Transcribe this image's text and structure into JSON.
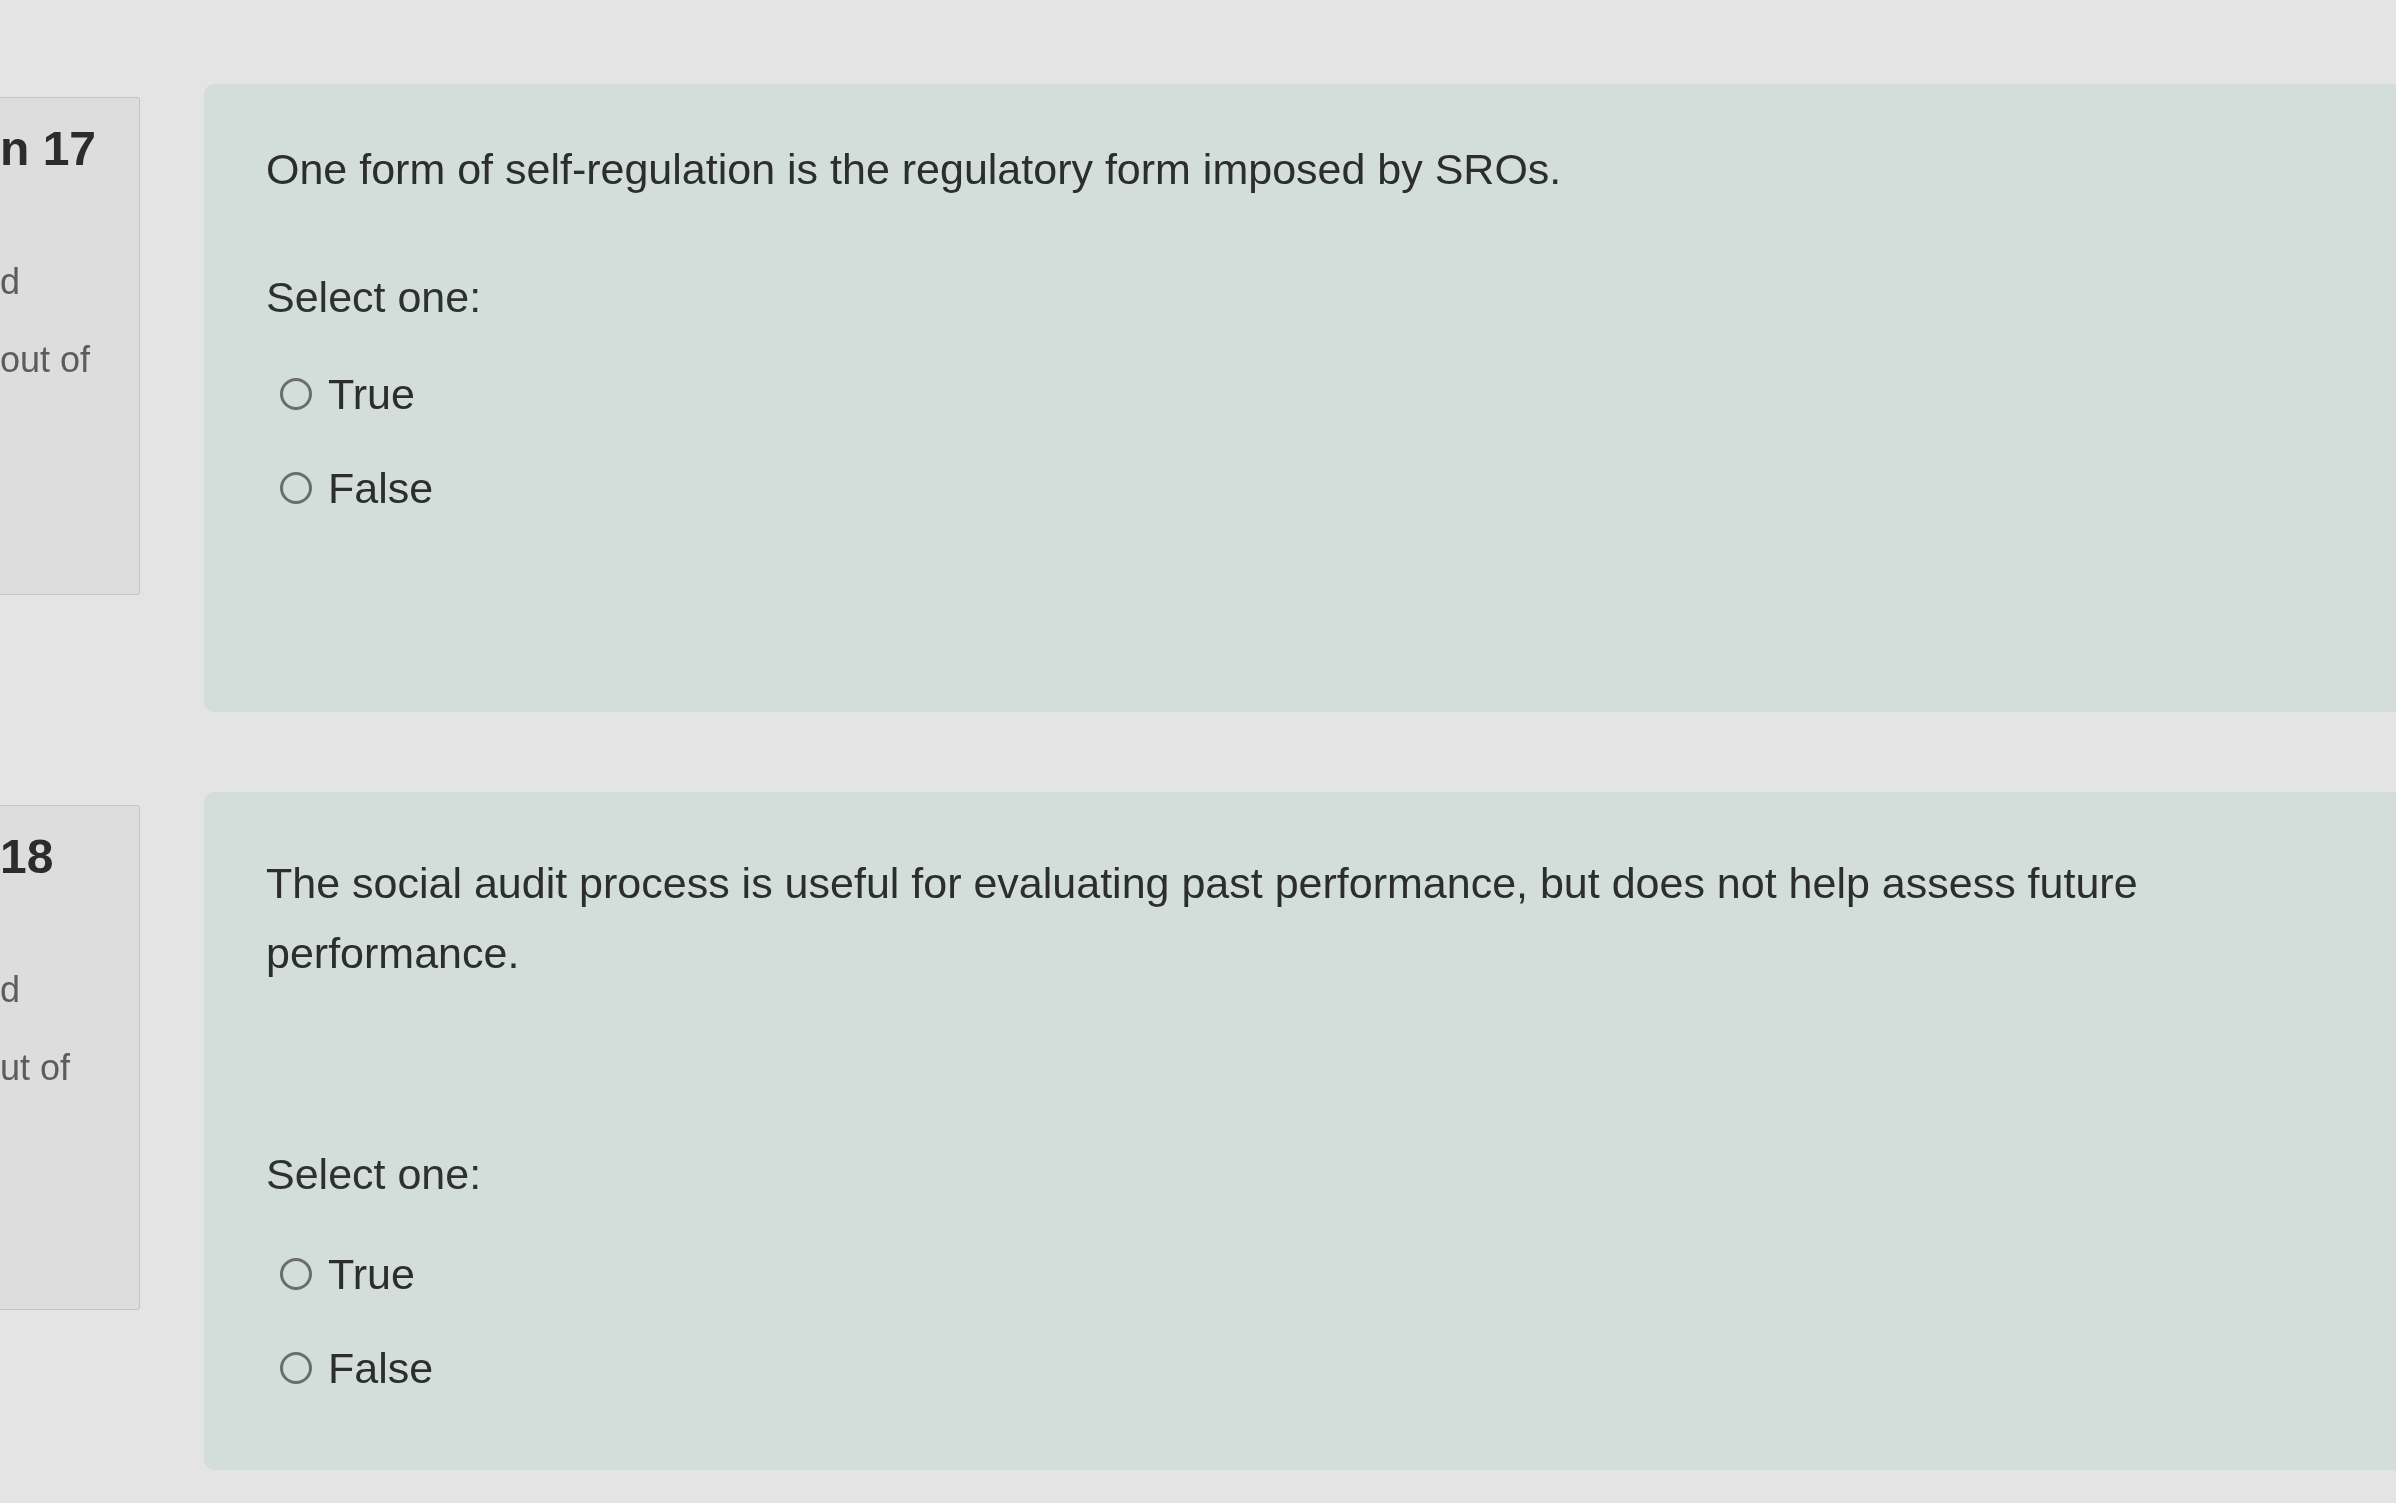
{
  "questions": [
    {
      "info": {
        "number": "n 17",
        "state": "d",
        "mark": "out of"
      },
      "text": "One form of self-regulation is the regulatory form imposed by SROs.",
      "prompt": "Select one:",
      "options": [
        {
          "label": "True",
          "selected": false
        },
        {
          "label": "False",
          "selected": false
        }
      ]
    },
    {
      "info": {
        "number": "18",
        "state": "d",
        "mark": "ut of"
      },
      "text": "The social audit process is useful for evaluating past performance, but does not help assess future performance.",
      "prompt": "Select one:",
      "options": [
        {
          "label": "True",
          "selected": false
        },
        {
          "label": "False",
          "selected": false
        }
      ]
    }
  ]
}
